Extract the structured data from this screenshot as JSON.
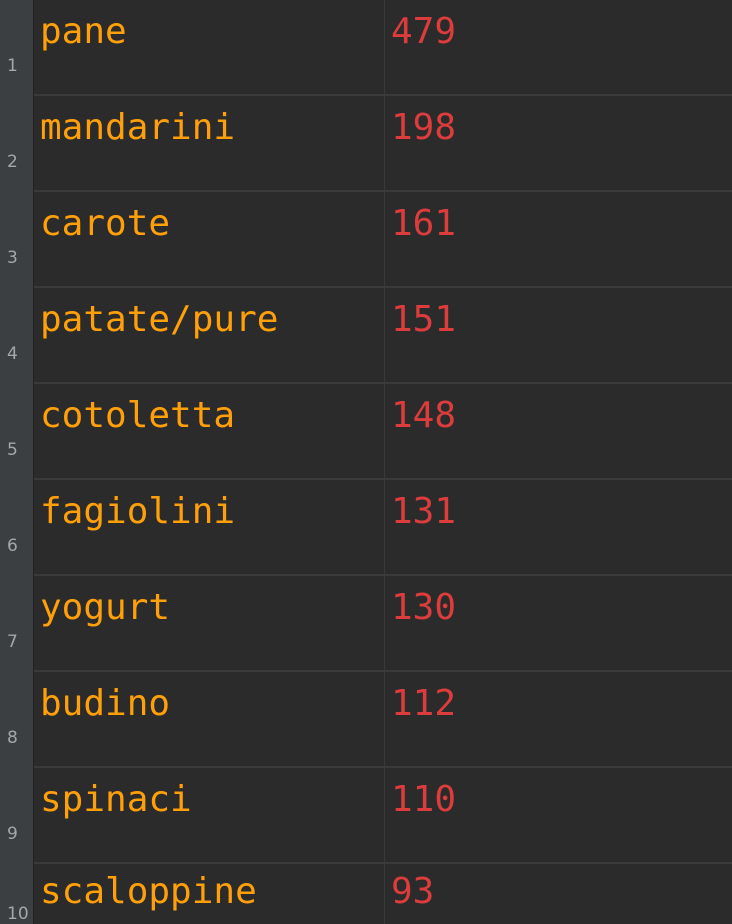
{
  "sheet": {
    "rows": [
      {
        "num": "1",
        "name": "pane",
        "value": "479"
      },
      {
        "num": "2",
        "name": "mandarini",
        "value": "198"
      },
      {
        "num": "3",
        "name": "carote",
        "value": "161"
      },
      {
        "num": "4",
        "name": "patate/pure",
        "value": "151"
      },
      {
        "num": "5",
        "name": "cotoletta",
        "value": "148"
      },
      {
        "num": "6",
        "name": "fagiolini",
        "value": "131"
      },
      {
        "num": "7",
        "name": "yogurt",
        "value": "130"
      },
      {
        "num": "8",
        "name": "budino",
        "value": "112"
      },
      {
        "num": "9",
        "name": "spinaci",
        "value": "110"
      },
      {
        "num": "10",
        "name": "scaloppine",
        "value": "93"
      }
    ]
  },
  "colors": {
    "background": "#2b2b2b",
    "gutter": "#3c3f41",
    "name_text": "#ff9f0a",
    "value_text": "#dc3c3c",
    "row_number": "#a4a7aa",
    "gridline": "#3a3a3a"
  }
}
